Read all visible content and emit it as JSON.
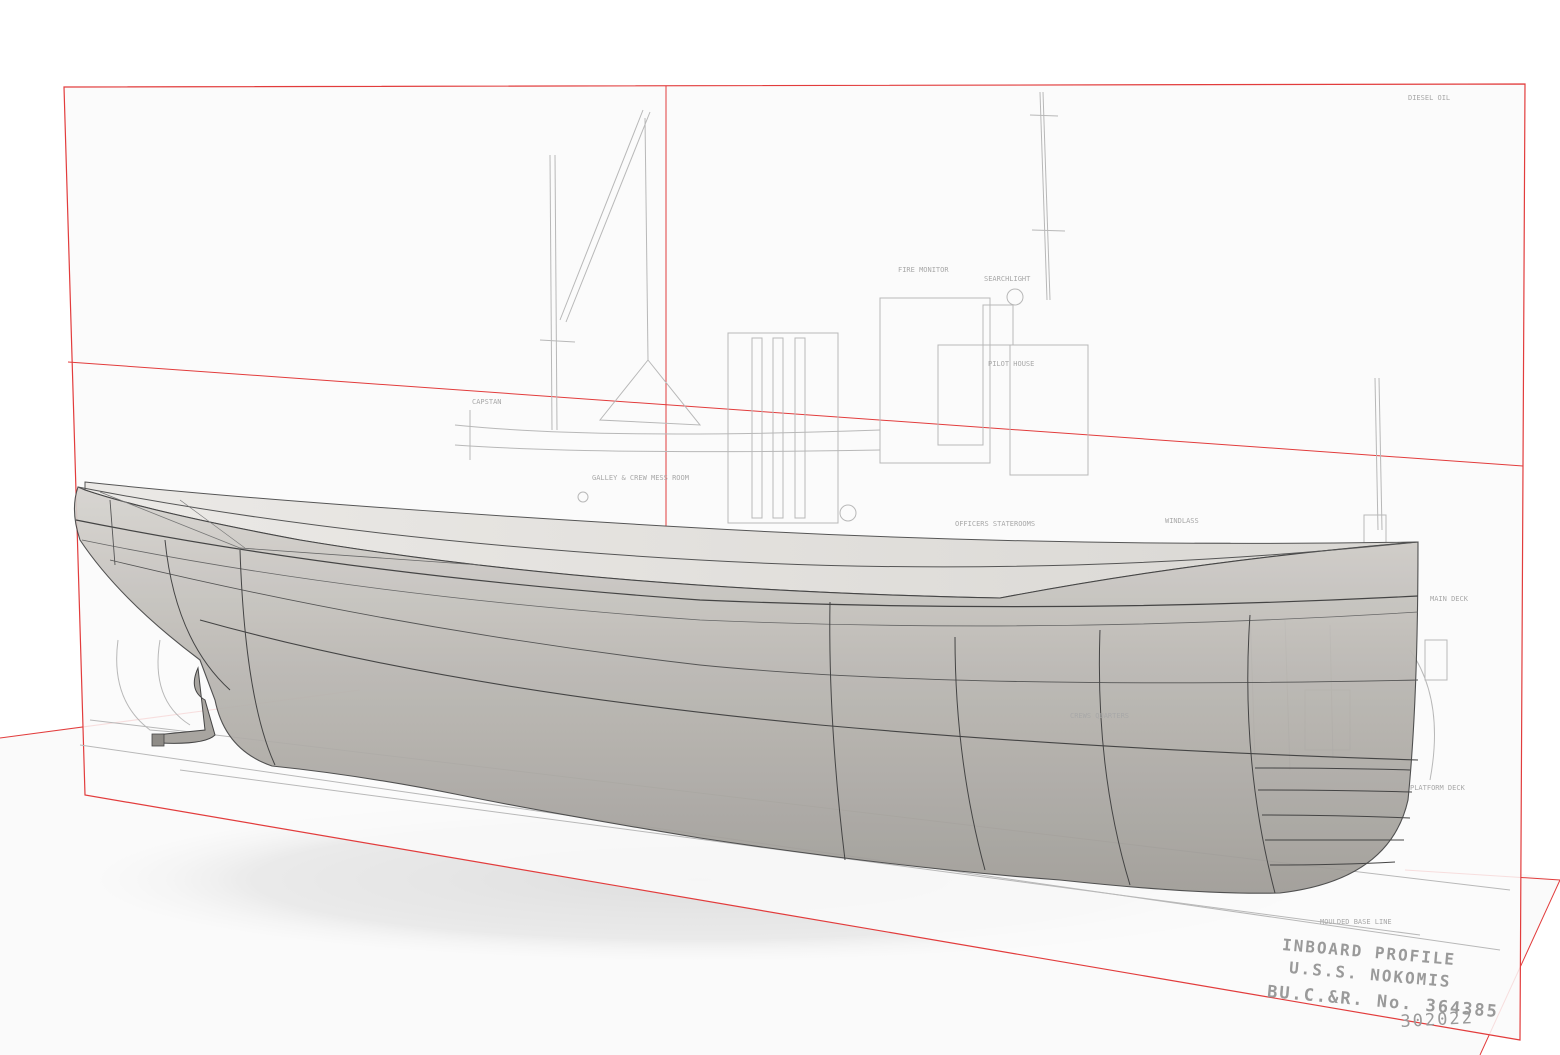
{
  "drawing": {
    "stamp_line_1": "INBOARD PROFILE",
    "stamp_line_2": "U.S.S. NOKOMIS",
    "stamp_line_3": "BU.C.&R. No. 364385",
    "drawing_number": "302022"
  },
  "annotations": {
    "searchlight": "SEARCHLIGHT",
    "fire_monitor": "FIRE MONITOR",
    "pilot_house": "PILOT HOUSE",
    "officers_staterooms": "OFFICERS STATEROOMS",
    "windlass": "WINDLASS",
    "main_deck": "MAIN DECK",
    "platform_deck": "PLATFORM DECK",
    "crews_quarters": "CREWS QUARTERS",
    "moulded_base_line": "MOULDED BASE LINE",
    "diesel_oil": "DIESEL OIL",
    "capstan": "CAPSTAN",
    "galley": "GALLEY & CREW MESS ROOM"
  },
  "colors": {
    "reference_plane": "#e23c3c",
    "hull": "#bdbab5",
    "hull_dark": "#8f8c87",
    "blueprint_ink": "#b8b8b8",
    "background": "#ffffff"
  }
}
